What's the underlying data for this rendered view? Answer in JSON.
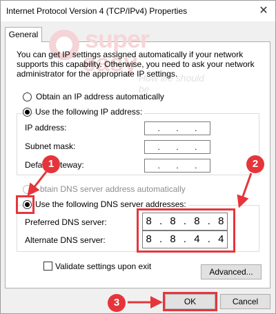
{
  "window": {
    "title": "Internet Protocol Version 4 (TCP/IPv4) Properties",
    "close_glyph": "✕"
  },
  "tabs": [
    {
      "label": "General"
    }
  ],
  "watermark": {
    "line1": "super",
    "line2": "easy",
    "tagline": "How life should be"
  },
  "intro_text": "You can get IP settings assigned automatically if your network supports this capability. Otherwise, you need to ask your network administrator for the appropriate IP settings.",
  "ip_options": {
    "auto_label": "Obtain an IP address automatically",
    "manual_label": "Use the following IP address:",
    "selected": "manual"
  },
  "ip_fields": {
    "ip_address": {
      "label": "IP address:",
      "octets": [
        "",
        "",
        "",
        ""
      ]
    },
    "subnet_mask": {
      "label": "Subnet mask:",
      "octets": [
        "",
        "",
        "",
        ""
      ]
    },
    "default_gateway": {
      "label": "Default gateway:",
      "visible_label_left": "Defau",
      "visible_label_right": "teway:",
      "octets": [
        "",
        "",
        "",
        ""
      ]
    },
    "separator": "."
  },
  "dns_options": {
    "auto_label": "Obtain DNS server address automatically",
    "auto_visible": "btain DNS server address automatically",
    "manual_label": "Use the following DNS server addresses:",
    "selected": "manual"
  },
  "dns_fields": {
    "preferred": {
      "label": "Preferred DNS server:",
      "octets": [
        "8",
        "8",
        "8",
        "8"
      ]
    },
    "alternate": {
      "label": "Alternate DNS server:",
      "octets": [
        "8",
        "8",
        "4",
        "4"
      ]
    }
  },
  "validate": {
    "label": "Validate settings upon exit",
    "checked": false
  },
  "buttons": {
    "advanced": "Advanced...",
    "ok": "OK",
    "cancel": "Cancel"
  },
  "annotations": {
    "badge1": "1",
    "badge2": "2",
    "badge3": "3",
    "color": "#e5353b"
  }
}
